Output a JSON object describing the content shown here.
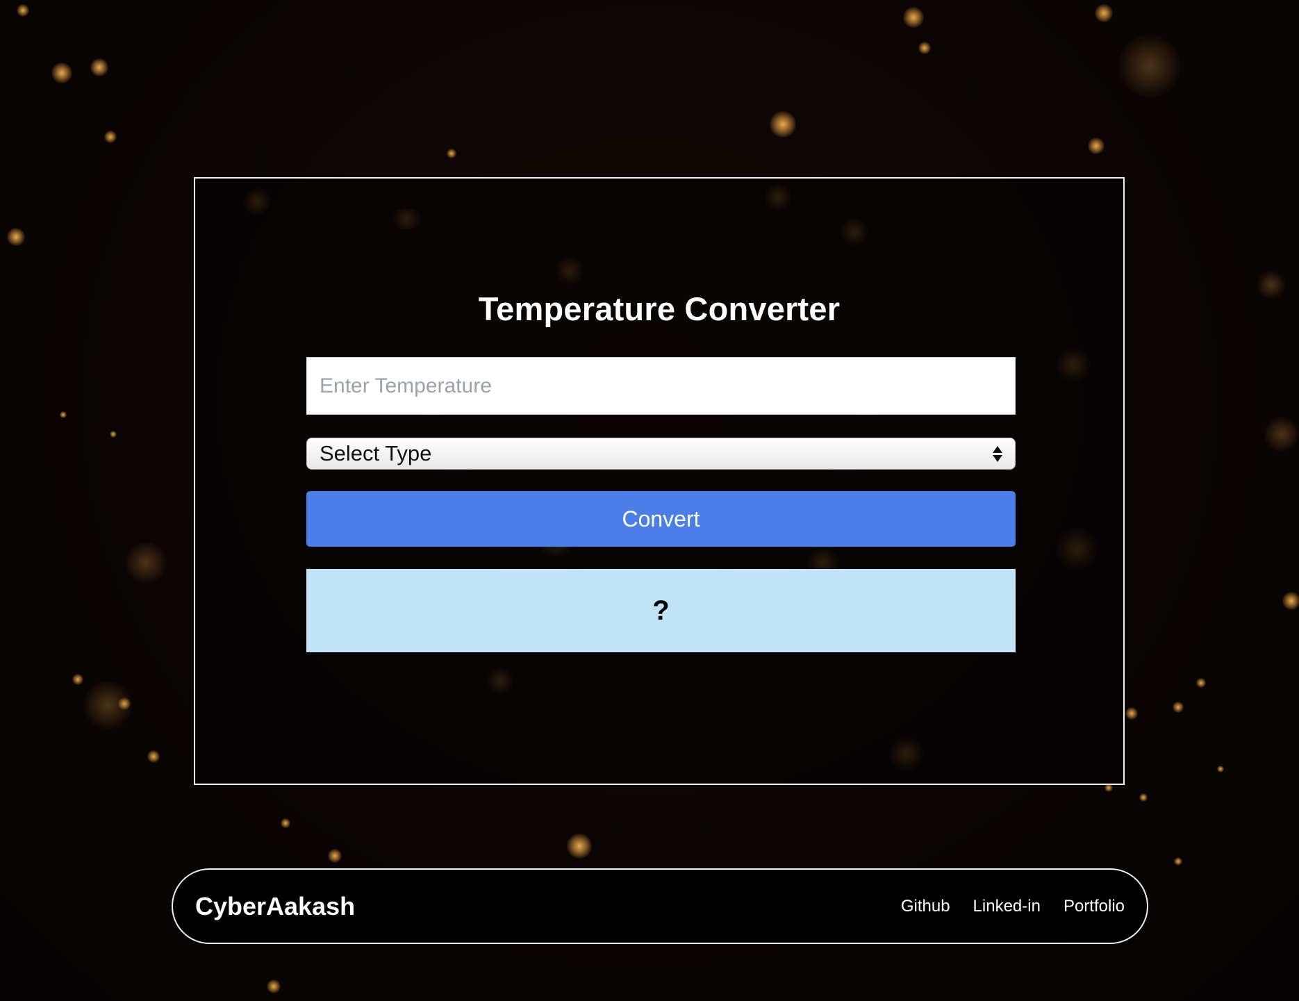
{
  "converter": {
    "title": "Temperature Converter",
    "input_placeholder": "Enter Temperature",
    "input_value": "",
    "select_value": "Select Type",
    "convert_label": "Convert",
    "result_text": "?"
  },
  "footer": {
    "brand": "CyberAakash",
    "links": [
      {
        "label": "Github"
      },
      {
        "label": "Linked-in"
      },
      {
        "label": "Portfolio"
      }
    ]
  },
  "colors": {
    "background": "#070302",
    "convert_button": "#4c7ee8",
    "result_box": "#c2e4f8",
    "bokeh": "#f0b45a"
  },
  "icons": {
    "select_arrows": "updown-arrows-icon"
  }
}
